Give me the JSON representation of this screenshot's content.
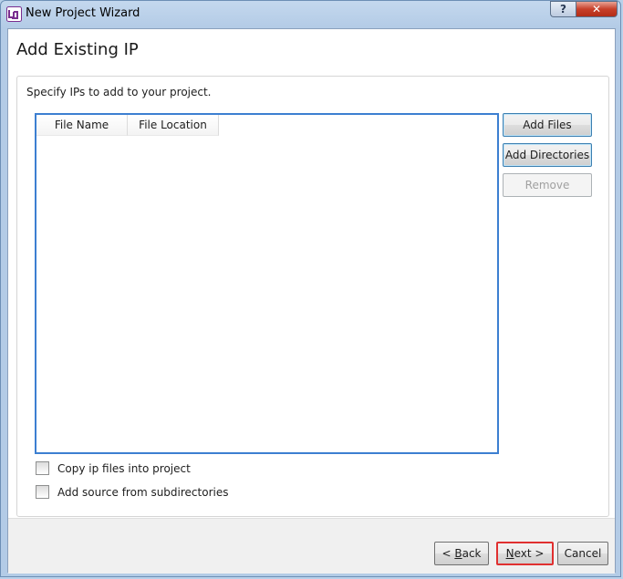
{
  "window": {
    "title": "New Project Wizard",
    "help_label": "?",
    "close_label": "✕"
  },
  "page": {
    "title": "Add Existing IP",
    "instruction": "Specify IPs to add to your project."
  },
  "table": {
    "columns": [
      "File Name",
      "File Location"
    ],
    "rows": []
  },
  "side_buttons": {
    "add_files": "Add Files",
    "add_directories": "Add Directories",
    "remove": "Remove"
  },
  "options": {
    "copy_ip": {
      "label": "Copy ip files into project",
      "checked": false
    },
    "add_subdirs": {
      "label": "Add source from subdirectories",
      "checked": false
    }
  },
  "footer": {
    "back_prefix": "< ",
    "back_mnemonic": "B",
    "back_rest": "ack",
    "next_mnemonic": "N",
    "next_rest": "ext >",
    "cancel": "Cancel"
  },
  "colors": {
    "table_border": "#3c7fd1",
    "highlight": "#e03030"
  }
}
